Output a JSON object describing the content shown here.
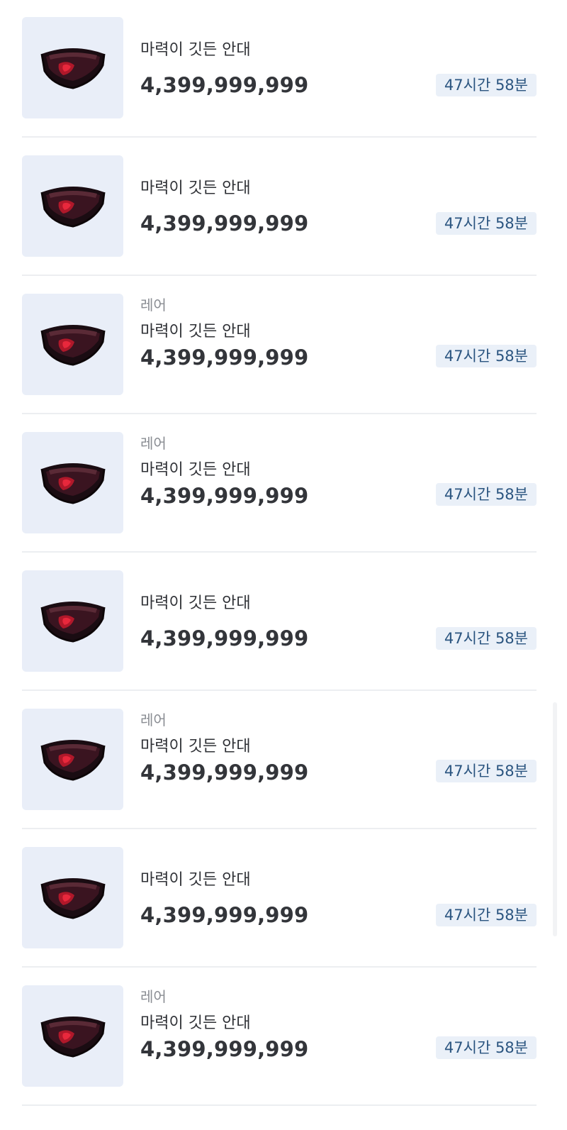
{
  "items": [
    {
      "grade": "",
      "name": "마력이 깃든 안대",
      "price": "4,399,999,999",
      "time": "47시간 58분",
      "icon": "eye-patch-icon"
    },
    {
      "grade": "",
      "name": "마력이 깃든 안대",
      "price": "4,399,999,999",
      "time": "47시간 58분",
      "icon": "eye-patch-icon"
    },
    {
      "grade": "레어",
      "name": "마력이 깃든 안대",
      "price": "4,399,999,999",
      "time": "47시간 58분",
      "icon": "eye-patch-icon"
    },
    {
      "grade": "레어",
      "name": "마력이 깃든 안대",
      "price": "4,399,999,999",
      "time": "47시간 58분",
      "icon": "eye-patch-icon"
    },
    {
      "grade": "",
      "name": "마력이 깃든 안대",
      "price": "4,399,999,999",
      "time": "47시간 58분",
      "icon": "eye-patch-icon"
    },
    {
      "grade": "레어",
      "name": "마력이 깃든 안대",
      "price": "4,399,999,999",
      "time": "47시간 58분",
      "icon": "eye-patch-icon"
    },
    {
      "grade": "",
      "name": "마력이 깃든 안대",
      "price": "4,399,999,999",
      "time": "47시간 58분",
      "icon": "eye-patch-icon"
    },
    {
      "grade": "레어",
      "name": "마력이 깃든 안대",
      "price": "4,399,999,999",
      "time": "47시간 58분",
      "icon": "eye-patch-icon"
    }
  ],
  "colors": {
    "thumb_bg": "#e9eef8",
    "badge_bg": "#eaf0f8",
    "badge_text": "#2b5580",
    "grade_text": "#8a8d93",
    "price_text": "#33353a"
  }
}
